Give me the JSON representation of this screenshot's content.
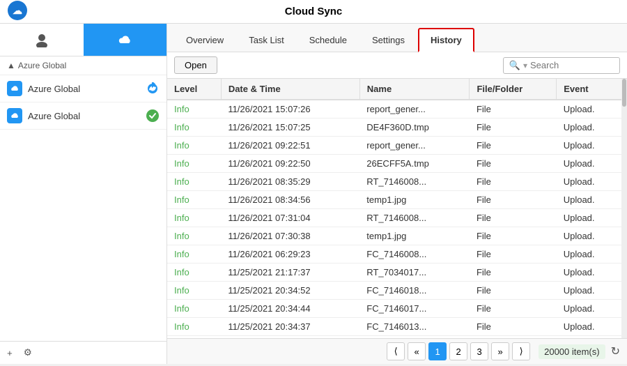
{
  "app": {
    "title": "Cloud Sync"
  },
  "sidebar": {
    "section_label": "Azure Global",
    "items": [
      {
        "label": "Azure Global",
        "status": "refresh"
      },
      {
        "label": "Azure Global",
        "status": "check"
      }
    ],
    "add_label": "+",
    "settings_label": "⚙"
  },
  "tabs": [
    {
      "label": "Overview",
      "active": false
    },
    {
      "label": "Task List",
      "active": false
    },
    {
      "label": "Schedule",
      "active": false
    },
    {
      "label": "Settings",
      "active": false
    },
    {
      "label": "History",
      "active": true
    }
  ],
  "toolbar": {
    "open_label": "Open",
    "search_placeholder": "Search"
  },
  "table": {
    "columns": [
      "Level",
      "Date & Time",
      "Name",
      "File/Folder",
      "Event"
    ],
    "rows": [
      {
        "level": "Info",
        "datetime": "11/26/2021 15:07:26",
        "name": "report_gener...",
        "type": "File",
        "event": "Upload."
      },
      {
        "level": "Info",
        "datetime": "11/26/2021 15:07:25",
        "name": "DE4F360D.tmp",
        "type": "File",
        "event": "Upload."
      },
      {
        "level": "Info",
        "datetime": "11/26/2021 09:22:51",
        "name": "report_gener...",
        "type": "File",
        "event": "Upload."
      },
      {
        "level": "Info",
        "datetime": "11/26/2021 09:22:50",
        "name": "26ECFF5A.tmp",
        "type": "File",
        "event": "Upload."
      },
      {
        "level": "Info",
        "datetime": "11/26/2021 08:35:29",
        "name": "RT_7146008...",
        "type": "File",
        "event": "Upload."
      },
      {
        "level": "Info",
        "datetime": "11/26/2021 08:34:56",
        "name": "temp1.jpg",
        "type": "File",
        "event": "Upload."
      },
      {
        "level": "Info",
        "datetime": "11/26/2021 07:31:04",
        "name": "RT_7146008...",
        "type": "File",
        "event": "Upload."
      },
      {
        "level": "Info",
        "datetime": "11/26/2021 07:30:38",
        "name": "temp1.jpg",
        "type": "File",
        "event": "Upload."
      },
      {
        "level": "Info",
        "datetime": "11/26/2021 06:29:23",
        "name": "FC_7146008...",
        "type": "File",
        "event": "Upload."
      },
      {
        "level": "Info",
        "datetime": "11/25/2021 21:17:37",
        "name": "RT_7034017...",
        "type": "File",
        "event": "Upload."
      },
      {
        "level": "Info",
        "datetime": "11/25/2021 20:34:52",
        "name": "FC_7146018...",
        "type": "File",
        "event": "Upload."
      },
      {
        "level": "Info",
        "datetime": "11/25/2021 20:34:44",
        "name": "FC_7146017...",
        "type": "File",
        "event": "Upload."
      },
      {
        "level": "Info",
        "datetime": "11/25/2021 20:34:37",
        "name": "FC_7146013...",
        "type": "File",
        "event": "Upload."
      }
    ]
  },
  "pagination": {
    "first_label": "⟨",
    "prev_label": "«",
    "pages": [
      "1",
      "2",
      "3"
    ],
    "next_label": "»",
    "last_label": "⟩",
    "items_count": "20000 item(s)",
    "current_page": "1"
  }
}
